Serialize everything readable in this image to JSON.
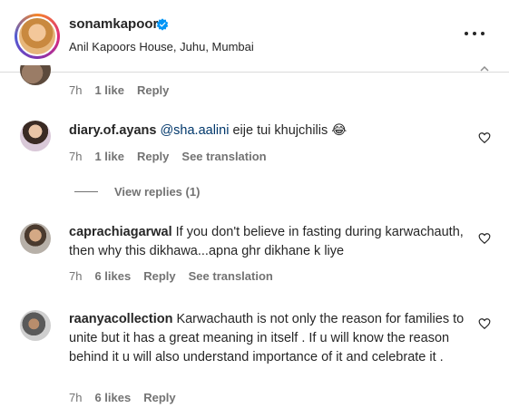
{
  "header": {
    "username": "sonamkapoor",
    "location": "Anil Kapoors House, Juhu, Mumbai"
  },
  "partial_comment": {
    "time": "7h",
    "likes": "1 like",
    "reply": "Reply"
  },
  "comments": [
    {
      "username": "diary.of.ayans",
      "mention": "@sha.aalini",
      "text": " eije tui khujchilis 😂",
      "time": "7h",
      "likes": "1 like",
      "reply": "Reply",
      "translate": "See translation",
      "view_replies": "View replies (1)"
    },
    {
      "username": "caprachiagarwal",
      "text": "If you don't believe in fasting during karwachauth, then why this dikhawa...apna ghr dikhane k liye",
      "time": "7h",
      "likes": "6 likes",
      "reply": "Reply",
      "translate": "See translation"
    },
    {
      "username": "raanyacollection",
      "text": "Karwachauth is not only the reason for families to unite but it has a great meaning in itself . If u will know the reason behind it u will also understand importance of it and celebrate it .",
      "time": "7h",
      "likes": "6 likes",
      "reply": "Reply"
    }
  ],
  "icons": {
    "verified": "verified-badge-icon",
    "more": "more-options-icon",
    "heart": "heart-outline-icon"
  },
  "colors": {
    "verified_blue": "#0095f6",
    "mention_blue": "#00376b",
    "secondary_text": "#737373"
  }
}
